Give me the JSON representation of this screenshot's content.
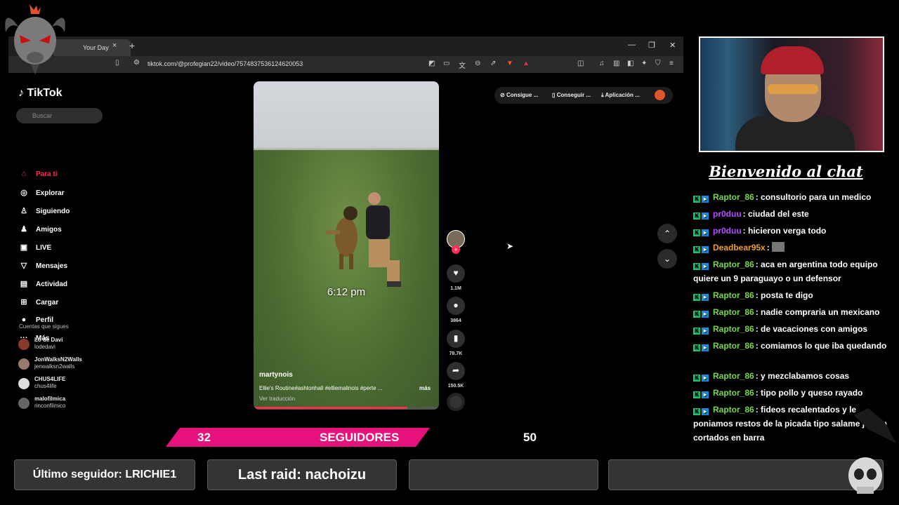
{
  "browser": {
    "tab_title": "Your Day",
    "tab_close": "×",
    "new_tab": "+",
    "window_controls": [
      "—",
      "❐",
      "✕"
    ],
    "url": "tiktok.com/@profegian22/video/7574837536124620053"
  },
  "tiktok": {
    "logo": "TikTok",
    "search_placeholder": "Buscar",
    "nav": [
      {
        "label": "Para ti",
        "icon": "⌂",
        "active": true
      },
      {
        "label": "Explorar",
        "icon": "◎"
      },
      {
        "label": "Siguiendo",
        "icon": "♙"
      },
      {
        "label": "Amigos",
        "icon": "♟"
      },
      {
        "label": "LIVE",
        "icon": "▣"
      },
      {
        "label": "Mensajes",
        "icon": "▽"
      },
      {
        "label": "Actividad",
        "icon": "▤"
      },
      {
        "label": "Cargar",
        "icon": "⊞"
      },
      {
        "label": "Perfil",
        "icon": "●"
      },
      {
        "label": "Más",
        "icon": "···"
      }
    ],
    "following_header": "Cuentas que sigues",
    "following": [
      {
        "name": "Lo de Davi",
        "handle": "lodedavi",
        "color": "#8a3a2a"
      },
      {
        "name": "JonWalksN2Walls",
        "handle": "jenwalksn2walls",
        "color": "#9a7a6a"
      },
      {
        "name": "CHUS4LIFE",
        "handle": "chus4life",
        "color": "#ddd"
      },
      {
        "name": "malofilmica",
        "handle": "rinconfilmico",
        "color": "#666"
      }
    ],
    "video": {
      "overlay_time": "6:12 pm",
      "author": "martynois",
      "caption": "Ellie's Routine#ashtonhall #elliemalinois #perte ...",
      "more": "más",
      "translate": "Ver traducción",
      "progress": 0.83
    },
    "actions": [
      {
        "name": "like",
        "icon": "♥",
        "count": "1.1M"
      },
      {
        "name": "comment",
        "icon": "●",
        "count": "3864"
      },
      {
        "name": "save",
        "icon": "▮",
        "count": "78.7K"
      },
      {
        "name": "share",
        "icon": "➦",
        "count": "150.5K"
      }
    ],
    "top_buttons": [
      "Consigue ...",
      "Conseguir ...",
      "Aplicación ..."
    ],
    "arrows": [
      "⌃",
      "⌄"
    ]
  },
  "chat": {
    "title": "Bienvenido al chat",
    "messages": [
      {
        "user": "Raptor_86",
        "color": "#7cd64a",
        "text": "consultorio para un medico"
      },
      {
        "user": "pr0duu",
        "color": "#b44dff",
        "text": "ciudad del este"
      },
      {
        "user": "pr0duu",
        "color": "#b44dff",
        "text": "hicieron verga todo"
      },
      {
        "user": "Deadbear95x",
        "color": "#f0a020",
        "text": ""
      },
      {
        "user": "Raptor_86",
        "color": "#7cd64a",
        "text": "aca en argentina todo equipo quiere un 9 paraguayo o un defensor"
      },
      {
        "user": "Raptor_86",
        "color": "#7cd64a",
        "text": "posta te digo"
      },
      {
        "user": "Raptor_86",
        "color": "#7cd64a",
        "text": "nadie compraria un mexicano"
      },
      {
        "user": "Raptor_86",
        "color": "#7cd64a",
        "text": "de vacaciones con amigos"
      },
      {
        "user": "Raptor_86",
        "color": "#7cd64a",
        "text": "comiamos lo que iba quedando"
      },
      {
        "user": "Raptor_86",
        "color": "#7cd64a",
        "text": "y mezclabamos cosas"
      },
      {
        "user": "Raptor_86",
        "color": "#7cd64a",
        "text": "tipo pollo y queso rayado"
      },
      {
        "user": "Raptor_86",
        "color": "#7cd64a",
        "text": "fideos recalentados y le poniamos restos de la picada tipo salame jamon cortados en barra"
      }
    ]
  },
  "goal": {
    "current": "32",
    "label": "SEGUIDORES",
    "target": "50"
  },
  "panels": {
    "last_follower": "Último seguidor: LRICHIE1",
    "last_raid": "Last raid: nachoizu",
    "panel3": "",
    "panel4": ""
  }
}
